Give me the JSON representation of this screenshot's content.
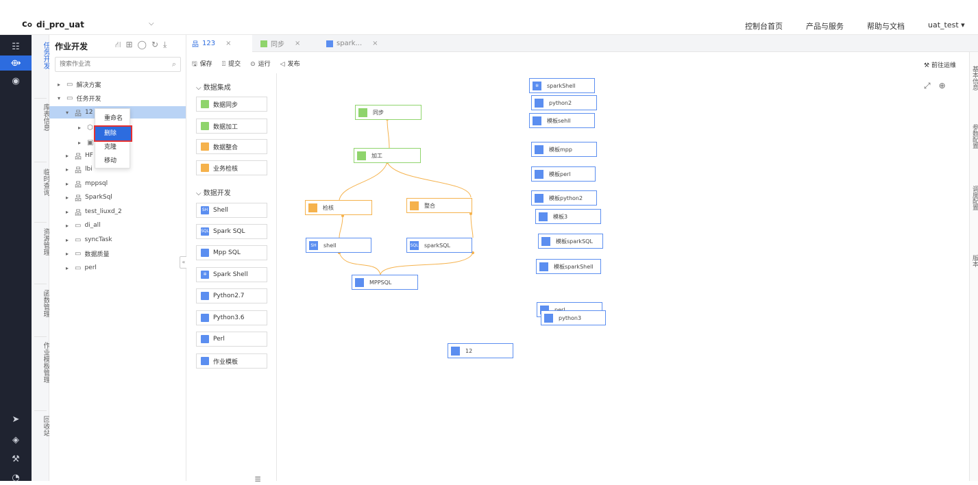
{
  "header": {
    "project": "di_pro_uat",
    "nav": [
      "控制台首页",
      "产品与服务",
      "帮助与文档"
    ],
    "user": "uat_test"
  },
  "vertical_menu": [
    "任务开发",
    "库表信息",
    "临时查询",
    "资源管理",
    "函数管理",
    "作业模板管理",
    "回收站"
  ],
  "tree": {
    "title": "作业开发",
    "search_placeholder": "搜索作业流",
    "nodes": [
      "解决方案",
      "任务开发",
      "12",
      "HF",
      "lbi",
      "mppsql",
      "SparkSql",
      "test_liuxd_2",
      "di_all",
      "syncTask",
      "数据质量",
      "perl"
    ],
    "context_menu": [
      "重命名",
      "删除",
      "克隆",
      "移动"
    ]
  },
  "tabs": [
    {
      "label": "123"
    },
    {
      "label": "同步"
    },
    {
      "label": "spark..."
    }
  ],
  "toolbar": {
    "save": "保存",
    "submit": "提交",
    "run": "运行",
    "publish": "发布",
    "goto_ops": "前往运维"
  },
  "palette": {
    "section1": "数据集成",
    "items1": [
      "数据同步",
      "数据加工",
      "数据整合",
      "业务检核"
    ],
    "section2": "数据开发",
    "items2": [
      "Shell",
      "Spark SQL",
      "Mpp SQL",
      "Spark Shell",
      "Python2.7",
      "Python3.6",
      "Perl",
      "作业模板"
    ]
  },
  "right_strip": [
    "基本信息",
    "参数配置",
    "调度配置",
    "版本"
  ],
  "canvas_nodes": {
    "sync": "同步",
    "process": "加工",
    "check": "检核",
    "integrate": "整合",
    "shell": "shell",
    "sparksql": "sparkSQL",
    "mppsql": "MPPSQL",
    "n12": "12",
    "sparkshell": "sparkShell",
    "python2": "python2",
    "tpl_sehll": "模板sehll",
    "tpl_mpp": "模板mpp",
    "tpl_perl": "模板perl",
    "tpl_python2": "模板python2",
    "tpl3": "模板3",
    "tpl_sparksql": "模板sparkSQL",
    "tpl_sparkshell": "模板sparkShell",
    "perl": "perl",
    "python3": "python3"
  },
  "colors": {
    "accent": "#2d6cdf",
    "green": "#8fd46c",
    "orange": "#f5b24c",
    "blue": "#5b8ef0",
    "rail": "#1f2330"
  }
}
